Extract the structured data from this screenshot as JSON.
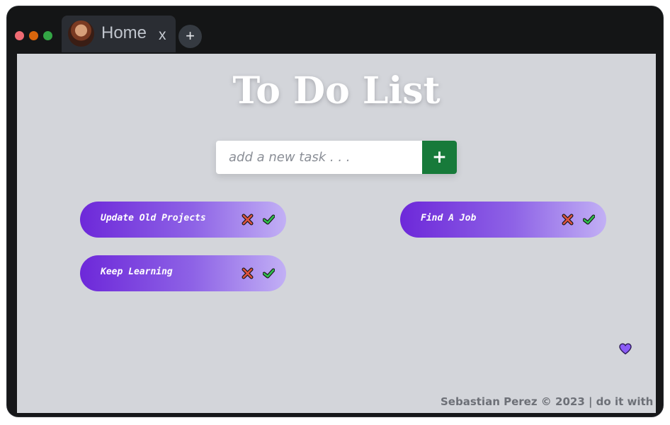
{
  "window": {
    "tab_title": "Home",
    "tab_close_label": "x",
    "new_tab_label": "+"
  },
  "page": {
    "title": "To Do List",
    "input": {
      "value": "",
      "placeholder": "add a new task . . ."
    },
    "add_button_label": "+"
  },
  "tasks": [
    {
      "label": "Update Old Projects"
    },
    {
      "label": "Find A Job"
    },
    {
      "label": "Keep Learning"
    }
  ],
  "footer": {
    "text": "Sebastian Perez © 2023 | do it with",
    "icon": "heart-icon"
  },
  "colors": {
    "add_button": "#177a3a",
    "task_gradient_start": "#6d28d9",
    "task_gradient_end": "#c2b0f5",
    "delete_icon": "#e0533f",
    "done_icon": "#2fbf4d",
    "heart": "#8b5cf6"
  }
}
